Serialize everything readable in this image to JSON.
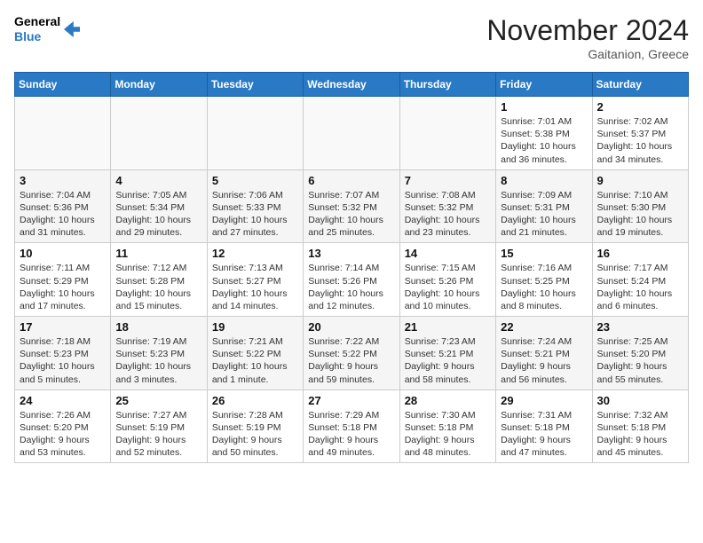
{
  "header": {
    "logo_line1": "General",
    "logo_line2": "Blue",
    "month_title": "November 2024",
    "location": "Gaitanion, Greece"
  },
  "weekdays": [
    "Sunday",
    "Monday",
    "Tuesday",
    "Wednesday",
    "Thursday",
    "Friday",
    "Saturday"
  ],
  "weeks": [
    [
      {
        "day": "",
        "info": ""
      },
      {
        "day": "",
        "info": ""
      },
      {
        "day": "",
        "info": ""
      },
      {
        "day": "",
        "info": ""
      },
      {
        "day": "",
        "info": ""
      },
      {
        "day": "1",
        "info": "Sunrise: 7:01 AM\nSunset: 5:38 PM\nDaylight: 10 hours\nand 36 minutes."
      },
      {
        "day": "2",
        "info": "Sunrise: 7:02 AM\nSunset: 5:37 PM\nDaylight: 10 hours\nand 34 minutes."
      }
    ],
    [
      {
        "day": "3",
        "info": "Sunrise: 7:04 AM\nSunset: 5:36 PM\nDaylight: 10 hours\nand 31 minutes."
      },
      {
        "day": "4",
        "info": "Sunrise: 7:05 AM\nSunset: 5:34 PM\nDaylight: 10 hours\nand 29 minutes."
      },
      {
        "day": "5",
        "info": "Sunrise: 7:06 AM\nSunset: 5:33 PM\nDaylight: 10 hours\nand 27 minutes."
      },
      {
        "day": "6",
        "info": "Sunrise: 7:07 AM\nSunset: 5:32 PM\nDaylight: 10 hours\nand 25 minutes."
      },
      {
        "day": "7",
        "info": "Sunrise: 7:08 AM\nSunset: 5:32 PM\nDaylight: 10 hours\nand 23 minutes."
      },
      {
        "day": "8",
        "info": "Sunrise: 7:09 AM\nSunset: 5:31 PM\nDaylight: 10 hours\nand 21 minutes."
      },
      {
        "day": "9",
        "info": "Sunrise: 7:10 AM\nSunset: 5:30 PM\nDaylight: 10 hours\nand 19 minutes."
      }
    ],
    [
      {
        "day": "10",
        "info": "Sunrise: 7:11 AM\nSunset: 5:29 PM\nDaylight: 10 hours\nand 17 minutes."
      },
      {
        "day": "11",
        "info": "Sunrise: 7:12 AM\nSunset: 5:28 PM\nDaylight: 10 hours\nand 15 minutes."
      },
      {
        "day": "12",
        "info": "Sunrise: 7:13 AM\nSunset: 5:27 PM\nDaylight: 10 hours\nand 14 minutes."
      },
      {
        "day": "13",
        "info": "Sunrise: 7:14 AM\nSunset: 5:26 PM\nDaylight: 10 hours\nand 12 minutes."
      },
      {
        "day": "14",
        "info": "Sunrise: 7:15 AM\nSunset: 5:26 PM\nDaylight: 10 hours\nand 10 minutes."
      },
      {
        "day": "15",
        "info": "Sunrise: 7:16 AM\nSunset: 5:25 PM\nDaylight: 10 hours\nand 8 minutes."
      },
      {
        "day": "16",
        "info": "Sunrise: 7:17 AM\nSunset: 5:24 PM\nDaylight: 10 hours\nand 6 minutes."
      }
    ],
    [
      {
        "day": "17",
        "info": "Sunrise: 7:18 AM\nSunset: 5:23 PM\nDaylight: 10 hours\nand 5 minutes."
      },
      {
        "day": "18",
        "info": "Sunrise: 7:19 AM\nSunset: 5:23 PM\nDaylight: 10 hours\nand 3 minutes."
      },
      {
        "day": "19",
        "info": "Sunrise: 7:21 AM\nSunset: 5:22 PM\nDaylight: 10 hours\nand 1 minute."
      },
      {
        "day": "20",
        "info": "Sunrise: 7:22 AM\nSunset: 5:22 PM\nDaylight: 9 hours\nand 59 minutes."
      },
      {
        "day": "21",
        "info": "Sunrise: 7:23 AM\nSunset: 5:21 PM\nDaylight: 9 hours\nand 58 minutes."
      },
      {
        "day": "22",
        "info": "Sunrise: 7:24 AM\nSunset: 5:21 PM\nDaylight: 9 hours\nand 56 minutes."
      },
      {
        "day": "23",
        "info": "Sunrise: 7:25 AM\nSunset: 5:20 PM\nDaylight: 9 hours\nand 55 minutes."
      }
    ],
    [
      {
        "day": "24",
        "info": "Sunrise: 7:26 AM\nSunset: 5:20 PM\nDaylight: 9 hours\nand 53 minutes."
      },
      {
        "day": "25",
        "info": "Sunrise: 7:27 AM\nSunset: 5:19 PM\nDaylight: 9 hours\nand 52 minutes."
      },
      {
        "day": "26",
        "info": "Sunrise: 7:28 AM\nSunset: 5:19 PM\nDaylight: 9 hours\nand 50 minutes."
      },
      {
        "day": "27",
        "info": "Sunrise: 7:29 AM\nSunset: 5:18 PM\nDaylight: 9 hours\nand 49 minutes."
      },
      {
        "day": "28",
        "info": "Sunrise: 7:30 AM\nSunset: 5:18 PM\nDaylight: 9 hours\nand 48 minutes."
      },
      {
        "day": "29",
        "info": "Sunrise: 7:31 AM\nSunset: 5:18 PM\nDaylight: 9 hours\nand 47 minutes."
      },
      {
        "day": "30",
        "info": "Sunrise: 7:32 AM\nSunset: 5:18 PM\nDaylight: 9 hours\nand 45 minutes."
      }
    ]
  ]
}
